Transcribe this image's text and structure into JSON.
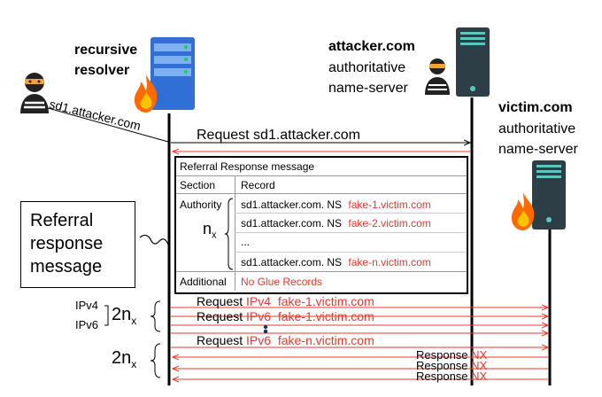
{
  "resolver": {
    "line1": "recursive",
    "line2": "resolver"
  },
  "attacker_ns": {
    "name": "attacker.com",
    "line2": "authoritative",
    "line3": "name-server"
  },
  "victim_ns": {
    "name": "victim.com",
    "line2": "authoritative",
    "line3": "name-server"
  },
  "client_query": "sd1.attacker.com",
  "request_top": "Request sd1.attacker.com",
  "referral_table": {
    "title": "Referral Response message",
    "col_section": "Section",
    "col_record": "Record",
    "authority_label": "Authority",
    "count_label": "n",
    "count_sub": "x",
    "records": [
      {
        "name": "sd1.attacker.com.",
        "type": "NS",
        "target": "fake-1.victim.com"
      },
      {
        "name": "sd1.attacker.com.",
        "type": "NS",
        "target": "fake-2.victim.com"
      },
      {
        "ellipsis": "..."
      },
      {
        "name": "sd1.attacker.com.",
        "type": "NS",
        "target": "fake-n.victim.com"
      }
    ],
    "additional_label": "Additional",
    "additional_value": "No Glue Records"
  },
  "callout": {
    "line1": "Referral",
    "line2": "response",
    "line3": "message"
  },
  "ip_labels": {
    "ipv4": "IPv4",
    "ipv6": "IPv6"
  },
  "group_count": {
    "main": "2n",
    "sub": "x"
  },
  "requests": [
    {
      "prefix": "Request",
      "type": "IPv4",
      "host": "fake-1.victim.com"
    },
    {
      "prefix": "Request",
      "type": "IPv6",
      "host": "fake-1.victim.com"
    },
    {
      "prefix": "Request",
      "type": "IPv6",
      "host": "fake-n.victim.com"
    }
  ],
  "responses": [
    {
      "label": "Response",
      "code": "NX"
    },
    {
      "label": "Response",
      "code": "NX"
    },
    {
      "label": "Response",
      "code": "NX"
    }
  ],
  "colors": {
    "red": "#e8382c",
    "server_blue": "#2f6fd6",
    "server_dark": "#2e3e46",
    "fire": "#ff6a00"
  }
}
